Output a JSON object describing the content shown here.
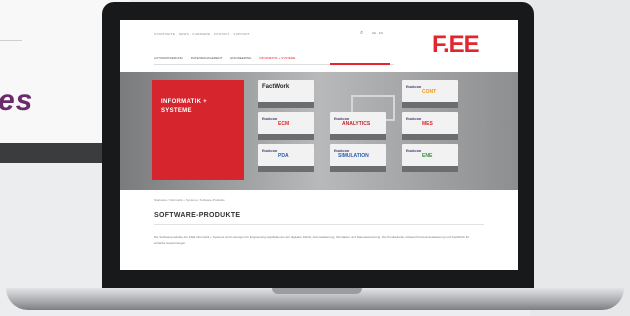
{
  "background": {
    "slogan": "es"
  },
  "website": {
    "top_links": "STARTSEITE · NEWS · KARRIERE · KONTAKT · SUPPORT",
    "language": "DE · EN",
    "logo": "F.EE",
    "main_nav": [
      {
        "label": "AUTOMATISIERUNG",
        "active": false
      },
      {
        "label": "DATENMANAGEMENT",
        "active": false
      },
      {
        "label": "ENGINEERING",
        "active": false
      },
      {
        "label": "INFORMATIK + SYSTEME",
        "active": true
      }
    ],
    "hero": {
      "title_line1": "INFORMATIK +",
      "title_line2": "SYSTEME"
    },
    "products": [
      {
        "brand": "FactWork",
        "name": ""
      },
      {
        "brand": "fluxicon",
        "name": "CONT"
      },
      {
        "brand": "fluxicon",
        "name": "ECM"
      },
      {
        "brand": "fluxicon",
        "name": "ANALYTICS"
      },
      {
        "brand": "fluxicon",
        "name": "MES"
      },
      {
        "brand": "fluxicon",
        "name": "PDA"
      },
      {
        "brand": "fluxicon",
        "name": "SIMULATION"
      },
      {
        "brand": "fluxicon",
        "name": "ENE"
      }
    ],
    "breadcrumb": "Startseite / Informatik + Systeme / Software-Produkte",
    "section_title": "SOFTWARE-PRODUKTE",
    "paragraph": "Die Softwareprodukte der F.EE Informatik + Systeme sind Lösungen für Engineering-Applikationen der digitalen Fabrik, Automatisierung, Simulation und Datenauswertung. Die Produktreihe umfasst Prozessvisualisierung und FactWork für einfache Auswertungen."
  },
  "colors": {
    "brand_red": "#e3262e",
    "screen_bezel": "#18191b"
  }
}
